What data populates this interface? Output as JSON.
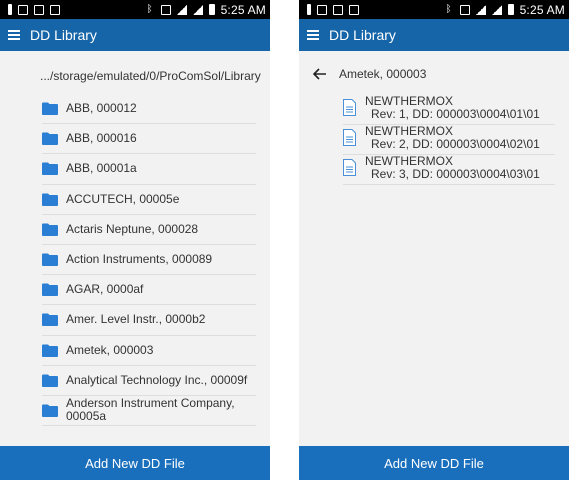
{
  "status_bar": {
    "time": "5:25 AM"
  },
  "app_bar": {
    "title": "DD Library",
    "menu_icon": "hamburger-menu-icon"
  },
  "left_screen": {
    "path": ".../storage/emulated/0/ProComSol/Library",
    "folders": [
      "ABB, 000012",
      "ABB, 000016",
      "ABB, 00001a",
      "ACCUTECH, 00005e",
      "Actaris Neptune, 000028",
      "Action Instruments, 000089",
      "AGAR, 0000af",
      "Amer. Level Instr., 0000b2",
      "Ametek, 000003",
      "Analytical Technology Inc., 00009f",
      "Anderson Instrument Company, 00005a"
    ],
    "bottom_button": "Add New DD File"
  },
  "right_screen": {
    "back_title": "Ametek, 000003",
    "files": [
      {
        "name": "NEWTHERMOX",
        "detail": "Rev: 1, DD: 000003\\0004\\01\\01"
      },
      {
        "name": "NEWTHERMOX",
        "detail": "Rev: 2, DD: 000003\\0004\\02\\01"
      },
      {
        "name": "NEWTHERMOX",
        "detail": "Rev: 3, DD: 000003\\0004\\03\\01"
      }
    ],
    "bottom_button": "Add New DD File"
  },
  "colors": {
    "app_bar": "#1565a8",
    "bottom_button": "#1a6fbd",
    "folder": "#2a7fd4",
    "file": "#4a90d9"
  }
}
